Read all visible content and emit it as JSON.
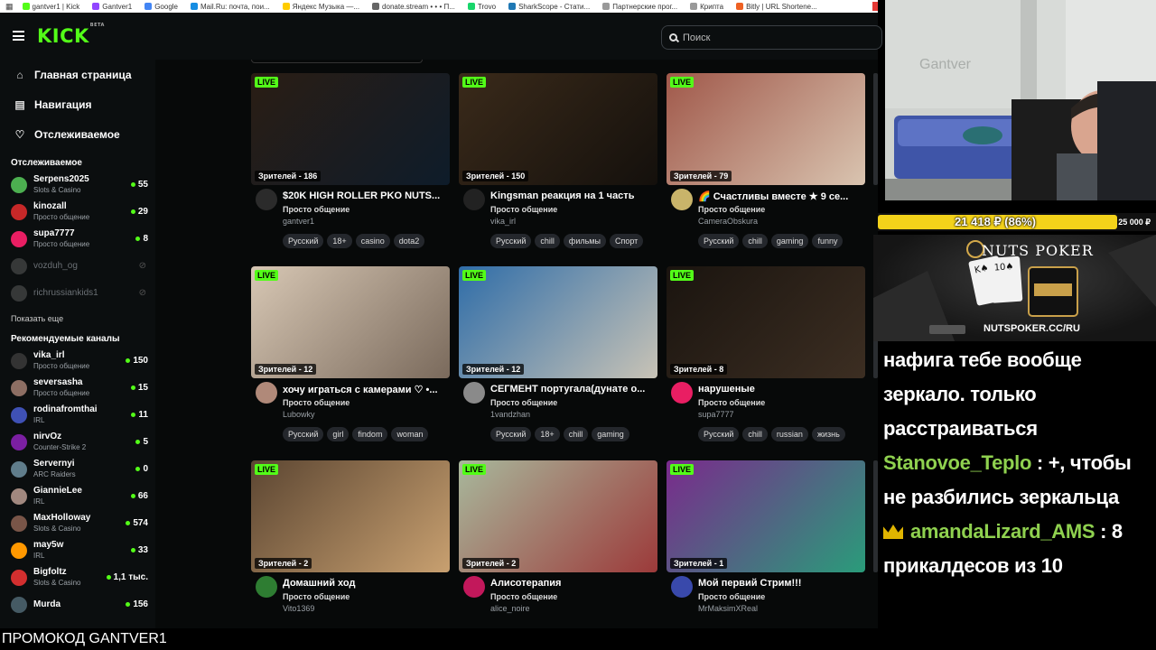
{
  "bookmarks": [
    {
      "label": "gantver1 | Kick",
      "color": "#53fc18"
    },
    {
      "label": "Gantver1",
      "color": "#9146ff"
    },
    {
      "label": "Google",
      "color": "#4285f4"
    },
    {
      "label": "Mail.Ru: почта, пои...",
      "color": "#168de2"
    },
    {
      "label": "Яндекс Музыка —...",
      "color": "#ffcc00"
    },
    {
      "label": "donate.stream • • • П...",
      "color": "#666666"
    },
    {
      "label": "Trovo",
      "color": "#19d66b"
    },
    {
      "label": "SharkScope - Стати...",
      "color": "#1f78b4"
    },
    {
      "label": "Партнерские прог...",
      "color": "#999999"
    },
    {
      "label": "Крипта",
      "color": "#999999"
    },
    {
      "label": "Bitly | URL Shortene...",
      "color": "#ee6123"
    }
  ],
  "header": {
    "logo": "KICK",
    "logo_badge": "BETA",
    "search_placeholder": "Поиск"
  },
  "sidebar": {
    "nav": [
      {
        "label": "Главная страница",
        "icon": "home-icon"
      },
      {
        "label": "Навигация",
        "icon": "compass-icon"
      },
      {
        "label": "Отслеживаемое",
        "icon": "heart-icon"
      }
    ],
    "following_title": "Отслеживаемое",
    "following": [
      {
        "name": "Serpens2025",
        "category": "Slots & Casino",
        "viewers": "55",
        "color": "#4caf50"
      },
      {
        "name": "kinozall",
        "category": "Просто общение",
        "viewers": "29",
        "color": "#c62828"
      },
      {
        "name": "supa7777",
        "category": "Просто общение",
        "viewers": "8",
        "color": "#e91e63"
      }
    ],
    "offline": [
      {
        "name": "vozduh_og"
      },
      {
        "name": "richrussiankids1"
      }
    ],
    "show_more": "Показать еще",
    "recommended_title": "Рекомендуемые каналы",
    "recommended": [
      {
        "name": "vika_irl",
        "category": "Просто общение",
        "viewers": "150",
        "color": "#333333"
      },
      {
        "name": "seversasha",
        "category": "Просто общение",
        "viewers": "15",
        "color": "#8d6e63"
      },
      {
        "name": "rodinafromthai",
        "category": "IRL",
        "viewers": "11",
        "color": "#3f51b5"
      },
      {
        "name": "nirvOz",
        "category": "Counter-Strike 2",
        "viewers": "5",
        "color": "#7b1fa2"
      },
      {
        "name": "Servernyi",
        "category": "ARC Raiders",
        "viewers": "0",
        "color": "#607d8b"
      },
      {
        "name": "GiannieLee",
        "category": "IRL",
        "viewers": "66",
        "color": "#a1887f"
      },
      {
        "name": "MaxHolloway",
        "category": "Slots & Casino",
        "viewers": "574",
        "color": "#795548"
      },
      {
        "name": "may5w",
        "category": "IRL",
        "viewers": "33",
        "color": "#ff9800"
      },
      {
        "name": "Bigfoltz",
        "category": "Slots & Casino",
        "viewers": "1,1 тыс.",
        "color": "#d32f2f"
      },
      {
        "name": "Murda",
        "category": "",
        "viewers": "156",
        "color": "#455a64"
      }
    ]
  },
  "streams": [
    {
      "title": "$20K HIGH ROLLER PKO NUTS...",
      "category": "Просто общение",
      "user": "gantver1",
      "viewers": "Зрителей - 186",
      "tags": [
        "Русский",
        "18+",
        "casino",
        "dota2"
      ],
      "thumb": [
        "#2a1d14",
        "#0e1c2a"
      ],
      "avatar": "#2b2b2b"
    },
    {
      "title": "Kingsman реакция на 1 часть",
      "category": "Просто общение",
      "user": "vika_irl",
      "viewers": "Зрителей - 150",
      "tags": [
        "Русский",
        "chill",
        "фильмы",
        "Спорт"
      ],
      "thumb": [
        "#3a2a1a",
        "#14100c"
      ],
      "avatar": "#222222"
    },
    {
      "title": "🌈 Счастливы вместе ★ 9 се...",
      "category": "Просто общение",
      "user": "CameraObskura",
      "viewers": "Зрителей - 79",
      "tags": [
        "Русский",
        "chill",
        "gaming",
        "funny"
      ],
      "thumb": [
        "#a0584a",
        "#d9c4b0"
      ],
      "avatar": "#c9b46a"
    },
    {
      "title": "хочу играться с камерами ♡ •...",
      "category": "Просто общение",
      "user": "Lubowky",
      "viewers": "Зрителей - 12",
      "tags": [
        "Русский",
        "girl",
        "findom",
        "woman"
      ],
      "thumb": [
        "#d7c7b4",
        "#7a6a5c"
      ],
      "avatar": "#b08979"
    },
    {
      "title": "СЕГМЕНТ португала(дунате о...",
      "category": "Просто общение",
      "user": "1vandzhan",
      "viewers": "Зрителей - 12",
      "tags": [
        "Русский",
        "18+",
        "chill",
        "gaming"
      ],
      "thumb": [
        "#2f6da8",
        "#c8c3b6"
      ],
      "avatar": "#8a8a8a"
    },
    {
      "title": "нарушеные",
      "category": "Просто общение",
      "user": "supa7777",
      "viewers": "Зрителей - 8",
      "tags": [
        "Русский",
        "chill",
        "russian",
        "жизнь"
      ],
      "thumb": [
        "#1a140f",
        "#3c2e22"
      ],
      "avatar": "#e91e63"
    },
    {
      "title": "Домашний ход",
      "category": "Просто общение",
      "user": "Vito1369",
      "viewers": "Зрителей - 2",
      "tags": [],
      "thumb": [
        "#5c4632",
        "#c8a070"
      ],
      "avatar": "#2e7d32"
    },
    {
      "title": "Алисотерапия",
      "category": "Просто общение",
      "user": "alice_noire",
      "viewers": "Зрителей - 2",
      "tags": [],
      "thumb": [
        "#a8b89c",
        "#9c3a3a"
      ],
      "avatar": "#c2185b"
    },
    {
      "title": "Мой первий Стрим!!!",
      "category": "Просто общение",
      "user": "MrMaksimXReal",
      "viewers": "Зрителей - 1",
      "tags": [],
      "thumb": [
        "#7a2a8c",
        "#2a9c7a"
      ],
      "avatar": "#3949ab"
    }
  ],
  "live_label": "LIVE",
  "promo": "ПРОМОКОД GANTVER1",
  "overlay": {
    "goal_text": "21 418 ₽ (86%)",
    "goal_progress": 0.86,
    "goal_max": "25 000 ₽",
    "banner_brand": "NUTS POKER",
    "banner_url": "NUTSPOKER.CC/RU",
    "wall_text": "Gantver"
  },
  "chat": [
    {
      "author": "",
      "text": "нафига тебе вообще зеркало. только расстраиваться"
    },
    {
      "author": "Stanovoe_Teplo",
      "text": "+, чтобы не разбились зеркальца"
    },
    {
      "author": "amandaLizard_AMS",
      "text": "8 прикалдесов из 10",
      "crown": true
    }
  ]
}
